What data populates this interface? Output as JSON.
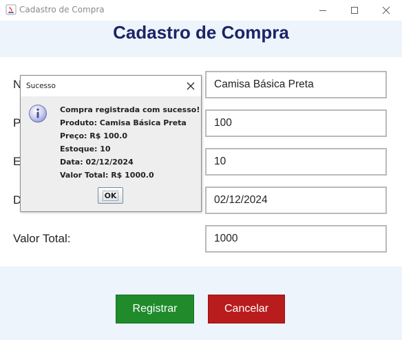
{
  "window": {
    "title": "Cadastro de Compra",
    "icon": "java-icon"
  },
  "page": {
    "title": "Cadastro de Compra"
  },
  "form": {
    "fields": [
      {
        "label": "Nome do Produto:",
        "visible_label": "N",
        "value": "Camisa Básica Preta"
      },
      {
        "label": "Preço:",
        "visible_label": "P",
        "value": "100"
      },
      {
        "label": "Estoque:",
        "visible_label": "E",
        "value": "10"
      },
      {
        "label": "Data:",
        "visible_label": "D",
        "value": "02/12/2024"
      },
      {
        "label": "Valor Total:",
        "visible_label": "Valor Total:",
        "value": "1000"
      }
    ]
  },
  "buttons": {
    "register": "Registrar",
    "cancel": "Cancelar"
  },
  "dialog": {
    "title": "Sucesso",
    "icon": "info-icon",
    "lines": [
      "Compra registrada com sucesso!",
      "Produto: Camisa Básica Preta",
      "Preço: R$ 100.0",
      "Estoque: 10",
      "Data: 02/12/2024",
      "Valor Total: R$ 1000.0"
    ],
    "ok_label": "OK"
  },
  "colors": {
    "title": "#1b2466",
    "register": "#1f8b2b",
    "cancel": "#b91c1c",
    "band": "#eef4fb"
  }
}
